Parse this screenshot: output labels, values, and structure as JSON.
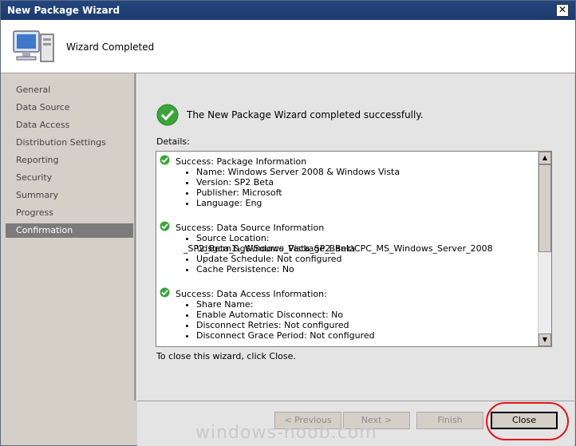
{
  "window": {
    "title": "New Package Wizard",
    "close_glyph": "✕"
  },
  "header": {
    "label": "Wizard Completed",
    "icon": "computer-icon"
  },
  "sidebar": {
    "items": [
      {
        "label": "General",
        "active": false
      },
      {
        "label": "Data Source",
        "active": false
      },
      {
        "label": "Data Access",
        "active": false
      },
      {
        "label": "Distribution Settings",
        "active": false
      },
      {
        "label": "Reporting",
        "active": false
      },
      {
        "label": "Security",
        "active": false
      },
      {
        "label": "Summary",
        "active": false
      },
      {
        "label": "Progress",
        "active": false
      },
      {
        "label": "Confirmation",
        "active": true
      }
    ]
  },
  "main": {
    "success_message": "The New Package Wizard completed successfully.",
    "details_label": "Details:",
    "close_hint": "To close this wizard, click Close.",
    "sections": [
      {
        "heading": "Success: Package Information",
        "items": [
          "Name: Windows Server 2008 & Windows Vista",
          "Version: SP2 Beta",
          "Publisher: Microsoft",
          "Language: Eng"
        ]
      },
      {
        "heading": "Success: Data Source Information",
        "items": [
          "Source Location: \\\\dsgcm1\\g$\\Source_Package_Bank\\CPC_MS_Windows_Server_2008",
          "_SP2_Beta_&_Windows_Vista_SP2_Beta",
          "Update Schedule: Not configured",
          "Cache Persistence: No"
        ]
      },
      {
        "heading": "Success: Data Access Information:",
        "items": [
          "Share Name:",
          "Enable Automatic Disconnect: No",
          "Disconnect Retries: Not configured",
          "Disconnect Grace Period: Not configured"
        ]
      }
    ]
  },
  "footer": {
    "previous_label": "< Previous",
    "next_label": "Next >",
    "finish_label": "Finish",
    "close_label": "Close"
  },
  "watermark": "windows-noob.com",
  "colors": {
    "titlebar": "#1c3a6e",
    "active_nav": "#7b7b7b",
    "success_green": "#3aa63a",
    "annotation_red": "#e3161c"
  }
}
